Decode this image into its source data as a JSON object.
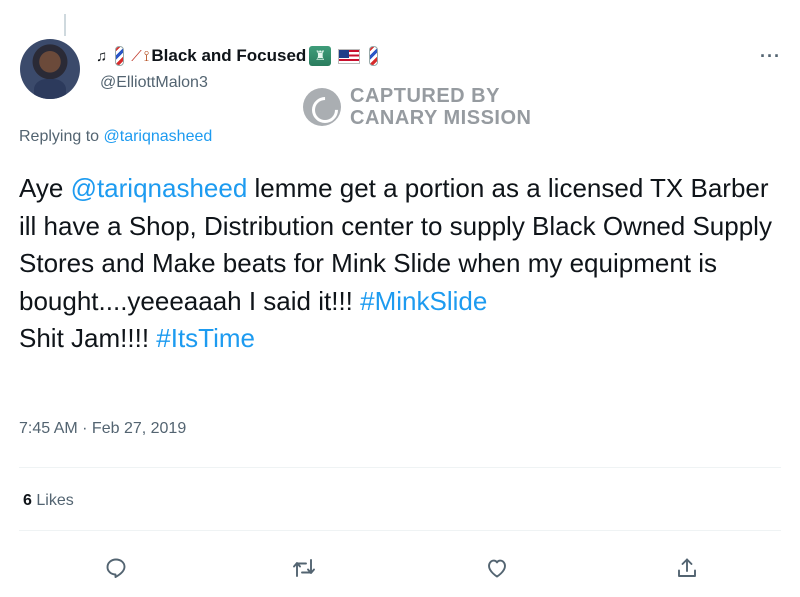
{
  "tweet": {
    "display_name": "Black and Focused",
    "handle": "@ElliottMalon3",
    "replying_prefix": "Replying to",
    "replying_to": "@tariqnasheed",
    "text_parts": {
      "p1": "Aye ",
      "mention": "@tariqnasheed",
      "p2": " lemme get a portion as a licensed TX Barber ill have a Shop, Distribution center to supply Black Owned Supply Stores and Make beats for Mink Slide when my equipment is bought....yeeeaaah I said it!!! ",
      "hashtag1": "#MinkSlide",
      "p3": "Shit Jam!!!! ",
      "hashtag2": "#ItsTime"
    },
    "timestamp": "7:45 AM · Feb 27, 2019",
    "likes_count": "6",
    "likes_label": "Likes",
    "more_label": "···"
  },
  "watermark": {
    "line1": "CAPTURED BY",
    "line2": "CANARY MISSION"
  },
  "colors": {
    "link": "#1d9bf0",
    "secondary_text": "#536471",
    "primary_text": "#0f1419"
  },
  "icons": {
    "name_decorations": [
      "music-notes-icon",
      "barber-pole-icon",
      "feather-icon",
      "bow-and-arrow-icon",
      "statue-of-liberty-icon",
      "us-flag-icon",
      "barber-pole-icon"
    ],
    "actions": [
      "reply-icon",
      "retweet-icon",
      "like-icon",
      "share-icon"
    ]
  }
}
